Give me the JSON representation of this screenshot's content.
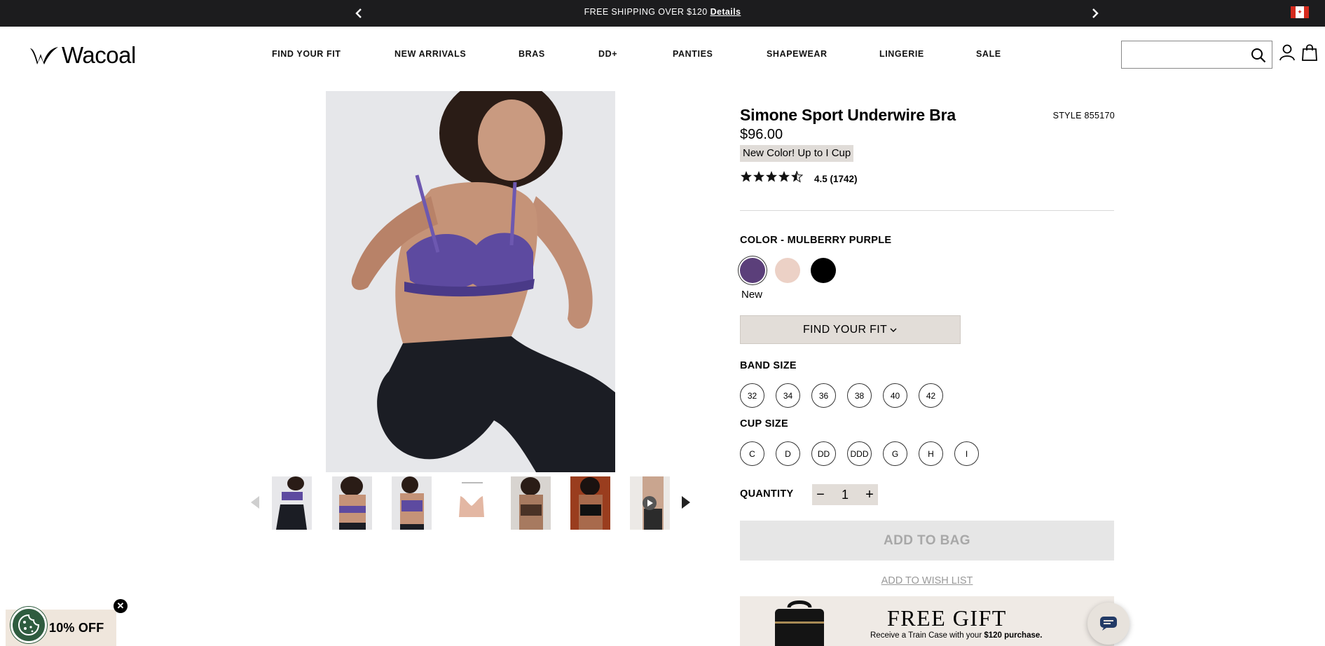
{
  "promo": {
    "message": "FREE SHIPPING OVER $120",
    "details_link": "Details",
    "prev_icon": "chevron-left-icon",
    "next_icon": "chevron-right-icon",
    "flag_icon": "canada-flag-icon"
  },
  "header": {
    "logo_text": "Wacoal",
    "nav": [
      "FIND YOUR FIT",
      "NEW ARRIVALS",
      "BRAS",
      "DD+",
      "PANTIES",
      "SHAPEWEAR",
      "LINGERIE",
      "SALE"
    ],
    "search": {
      "placeholder": "",
      "icon": "search-icon"
    },
    "icons": [
      "account-icon",
      "shopping-bag-icon"
    ]
  },
  "gallery": {
    "thumbnails": [
      "front-purple",
      "back-purple",
      "side-purple",
      "diagram",
      "front-rose",
      "front-black",
      "video"
    ],
    "prev_icon": "caret-left-icon",
    "next_icon": "caret-right-icon",
    "video_icon": "play-icon"
  },
  "product": {
    "title": "Simone Sport Underwire Bra",
    "style": "STYLE 855170",
    "price": "$96.00",
    "badge": "New Color! Up to I Cup",
    "rating_value": 4.5,
    "rating_text": "4.5 (1742)",
    "color_label": "COLOR - MULBERRY PURPLE",
    "swatches": [
      {
        "name": "Mulberry Purple",
        "color": "#5b3f7a",
        "selected": true
      },
      {
        "name": "Rose",
        "color": "#ecd1c6",
        "selected": false
      },
      {
        "name": "Black",
        "color": "#000000",
        "selected": false
      }
    ],
    "new_tag": "New",
    "find_fit_label": "FIND YOUR FIT",
    "band_label": "BAND SIZE",
    "band_sizes": [
      "32",
      "34",
      "36",
      "38",
      "40",
      "42"
    ],
    "cup_label": "CUP SIZE",
    "cup_sizes": [
      "C",
      "D",
      "DD",
      "DDD",
      "G",
      "H",
      "I"
    ],
    "quantity_label": "QUANTITY",
    "quantity": "1",
    "add_to_bag": "ADD TO BAG",
    "wish_list": "ADD TO WISH LIST"
  },
  "gift": {
    "heading": "FREE GIFT",
    "sub_prefix": "Receive a Train Case with your ",
    "sub_bold": "$120 purchase."
  },
  "offer": {
    "text": "10% OFF",
    "close_icon": "close-icon",
    "cookie_icon": "cookie-icon"
  },
  "chat": {
    "icon": "chat-icon"
  },
  "colors": {
    "promo_bg": "#1c1c1e",
    "button_bg": "#e2ddd8",
    "add_bg": "#e6e6e6"
  }
}
